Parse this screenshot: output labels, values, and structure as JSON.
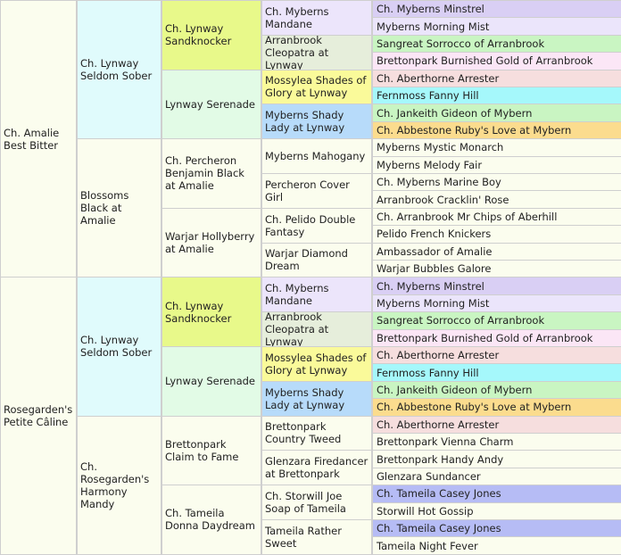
{
  "colors": {
    "cream": "#fbfdee",
    "cyan_light": "#e0fbfc",
    "lime": "#e8f98a",
    "mint": "#e2fbe6",
    "lavender": "#ece5fb",
    "sage": "#e6eedb",
    "yellow": "#fafa9a",
    "blue": "#b7dbfa",
    "purple": "#d9cff4",
    "lavender_light": "#ebe5fb",
    "green": "#c9f5c2",
    "pink": "#fbe6f6",
    "peach": "#f6dede",
    "aqua": "#a5f8fb",
    "orange": "#fbdc8e",
    "periwinkle": "#b6bcf5",
    "white": "#ffffff",
    "border": "#cfcfcf"
  },
  "pedigree": {
    "gen1": [
      {
        "name": "Ch. Amalie Best Bitter",
        "color": "cream"
      },
      {
        "name": "Rosegarden's Petite Câline",
        "color": "cream"
      }
    ],
    "gen2": [
      {
        "name": "Ch. Lynway Seldom Sober",
        "color": "cyan_light"
      },
      {
        "name": "Blossoms Black at Amalie",
        "color": "cream"
      },
      {
        "name": "Ch. Lynway Seldom Sober",
        "color": "cyan_light"
      },
      {
        "name": "Ch. Rosegarden's Harmony Mandy",
        "color": "cream"
      }
    ],
    "gen3": [
      {
        "name": "Ch. Lynway Sandknocker",
        "color": "lime"
      },
      {
        "name": "Lynway Serenade",
        "color": "mint"
      },
      {
        "name": "Ch. Percheron Benjamin Black at Amalie",
        "color": "cream"
      },
      {
        "name": "Warjar Hollyberry at Amalie",
        "color": "cream"
      },
      {
        "name": "Ch. Lynway Sandknocker",
        "color": "lime"
      },
      {
        "name": "Lynway Serenade",
        "color": "mint"
      },
      {
        "name": "Brettonpark Claim to Fame",
        "color": "cream"
      },
      {
        "name": "Ch. Tameila Donna Daydream",
        "color": "cream"
      }
    ],
    "gen4": [
      {
        "name": "Ch. Myberns Mandane",
        "color": "lavender"
      },
      {
        "name": "Arranbrook Cleopatra at Lynway",
        "color": "sage"
      },
      {
        "name": "Mossylea Shades of Glory at Lynway",
        "color": "yellow"
      },
      {
        "name": "Myberns Shady Lady at Lynway",
        "color": "blue"
      },
      {
        "name": "Myberns Mahogany",
        "color": "cream"
      },
      {
        "name": "Percheron Cover Girl",
        "color": "cream"
      },
      {
        "name": "Ch. Pelido Double Fantasy",
        "color": "cream"
      },
      {
        "name": "Warjar Diamond Dream",
        "color": "cream"
      },
      {
        "name": "Ch. Myberns Mandane",
        "color": "lavender"
      },
      {
        "name": "Arranbrook Cleopatra at Lynway",
        "color": "sage"
      },
      {
        "name": "Mossylea Shades of Glory at Lynway",
        "color": "yellow"
      },
      {
        "name": "Myberns Shady Lady at Lynway",
        "color": "blue"
      },
      {
        "name": "Brettonpark Country Tweed",
        "color": "cream"
      },
      {
        "name": "Glenzara Firedancer at Brettonpark",
        "color": "cream"
      },
      {
        "name": "Ch. Storwill Joe Soap of Tameila",
        "color": "cream"
      },
      {
        "name": "Tameila Rather Sweet",
        "color": "cream"
      }
    ],
    "gen5": [
      {
        "name": "Ch. Myberns Minstrel",
        "color": "purple"
      },
      {
        "name": "Myberns Morning Mist",
        "color": "lavender_light"
      },
      {
        "name": "Sangreat Sorrocco of Arranbrook",
        "color": "green"
      },
      {
        "name": "Brettonpark Burnished Gold of Arranbrook",
        "color": "pink"
      },
      {
        "name": "Ch. Aberthorne Arrester",
        "color": "peach"
      },
      {
        "name": "Fernmoss Fanny Hill",
        "color": "aqua"
      },
      {
        "name": "Ch. Jankeith Gideon of Mybern",
        "color": "green"
      },
      {
        "name": "Ch. Abbestone Ruby's Love at Mybern",
        "color": "orange"
      },
      {
        "name": "Myberns Mystic Monarch",
        "color": "cream"
      },
      {
        "name": "Myberns Melody Fair",
        "color": "cream"
      },
      {
        "name": "Ch. Myberns Marine Boy",
        "color": "cream"
      },
      {
        "name": "Arranbrook Cracklin' Rose",
        "color": "cream"
      },
      {
        "name": "Ch. Arranbrook Mr Chips of Aberhill",
        "color": "cream"
      },
      {
        "name": "Pelido French Knickers",
        "color": "cream"
      },
      {
        "name": "Ambassador of Amalie",
        "color": "cream"
      },
      {
        "name": "Warjar Bubbles Galore",
        "color": "cream"
      },
      {
        "name": "Ch. Myberns Minstrel",
        "color": "purple"
      },
      {
        "name": "Myberns Morning Mist",
        "color": "lavender_light"
      },
      {
        "name": "Sangreat Sorrocco of Arranbrook",
        "color": "green"
      },
      {
        "name": "Brettonpark Burnished Gold of Arranbrook",
        "color": "pink"
      },
      {
        "name": "Ch. Aberthorne Arrester",
        "color": "peach"
      },
      {
        "name": "Fernmoss Fanny Hill",
        "color": "aqua"
      },
      {
        "name": "Ch. Jankeith Gideon of Mybern",
        "color": "green"
      },
      {
        "name": "Ch. Abbestone Ruby's Love at Mybern",
        "color": "orange"
      },
      {
        "name": "Ch. Aberthorne Arrester",
        "color": "peach"
      },
      {
        "name": "Brettonpark Vienna Charm",
        "color": "cream"
      },
      {
        "name": "Brettonpark Handy Andy",
        "color": "cream"
      },
      {
        "name": "Glenzara Sundancer",
        "color": "cream"
      },
      {
        "name": "Ch. Tameila Casey Jones",
        "color": "periwinkle"
      },
      {
        "name": "Storwill Hot Gossip",
        "color": "cream"
      },
      {
        "name": "Ch. Tameila Casey Jones",
        "color": "periwinkle"
      },
      {
        "name": "Tameila Night Fever",
        "color": "cream"
      }
    ]
  }
}
